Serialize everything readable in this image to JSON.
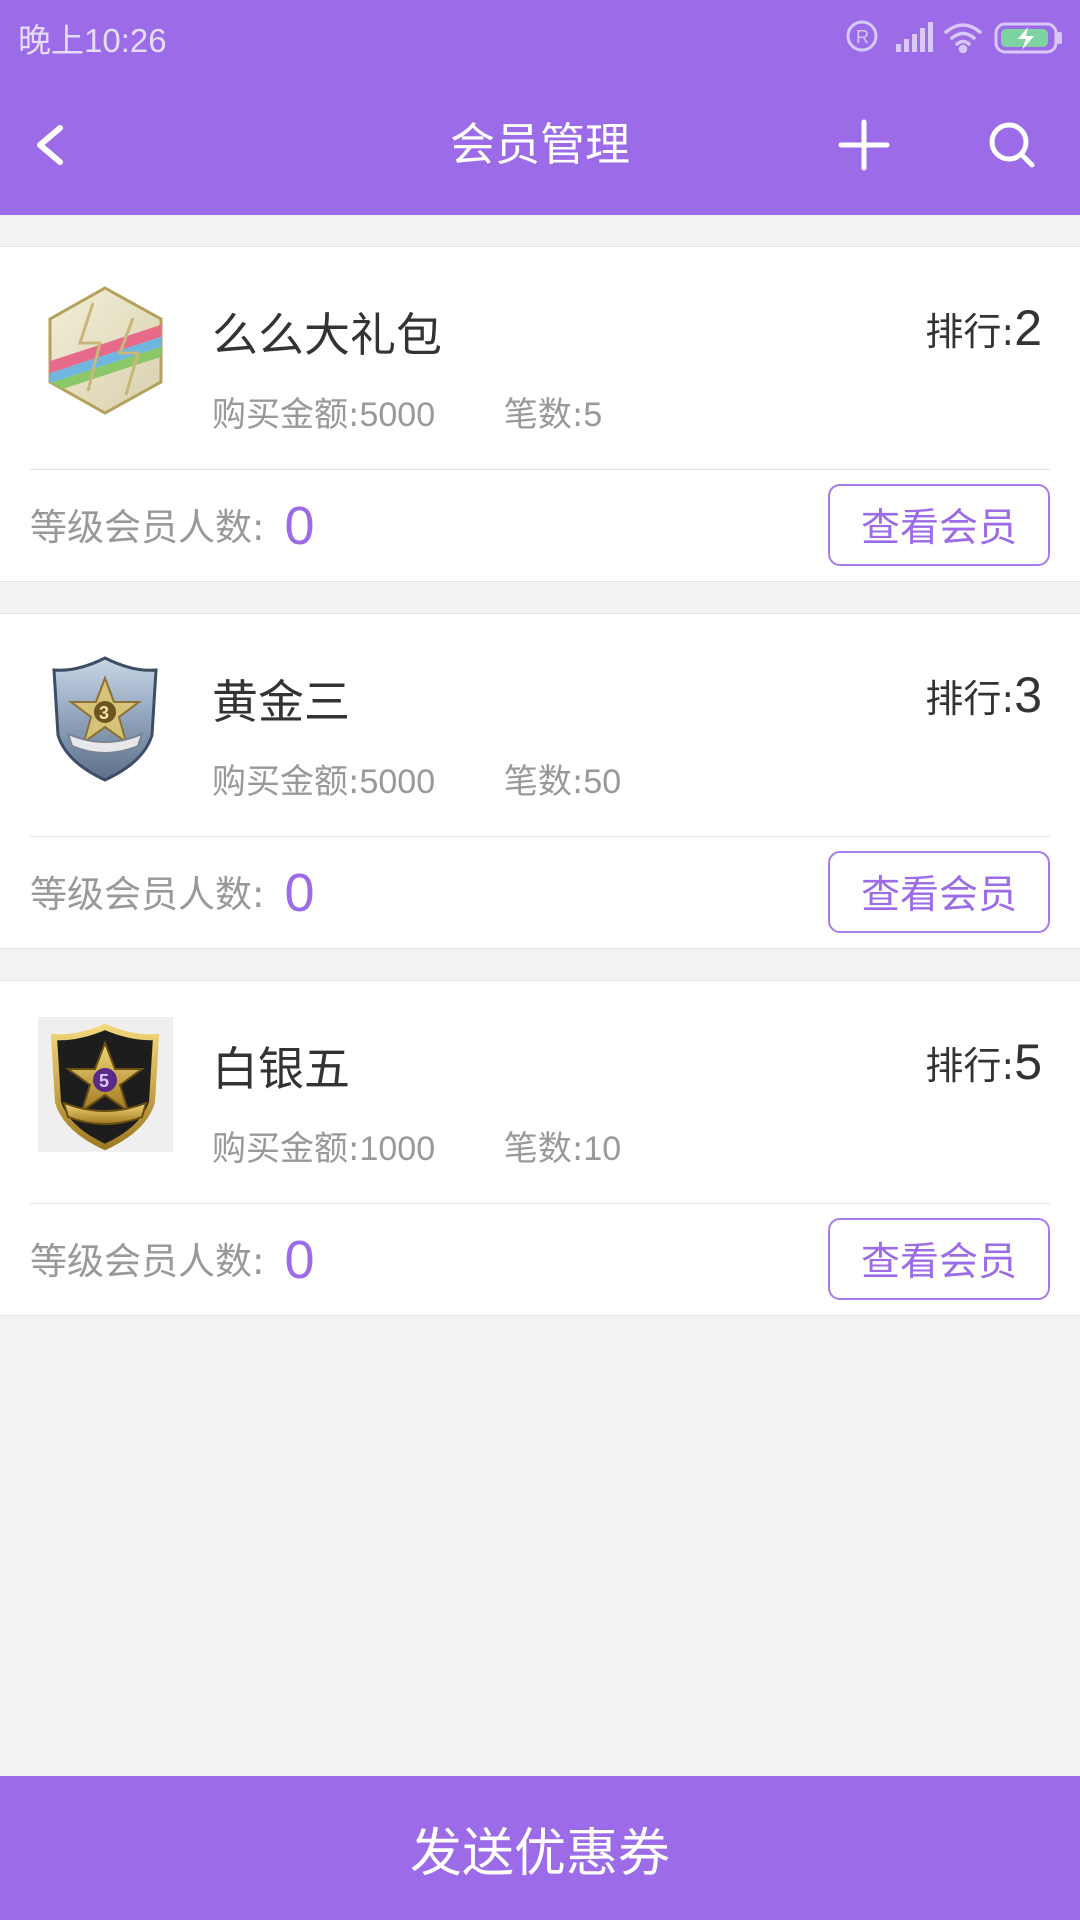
{
  "status_bar": {
    "time": "晚上10:26"
  },
  "header": {
    "title": "会员管理",
    "back_icon": "back-icon",
    "add_icon": "plus-icon",
    "search_icon": "search-icon"
  },
  "levels": [
    {
      "name": "么么大礼包",
      "rank_label": "排行:",
      "rank": "2",
      "amount_label": "购买金额:",
      "amount": "5000",
      "count_label": "笔数:",
      "count": "5",
      "members_label": "等级会员人数:",
      "members": "0",
      "button": "查看会员",
      "badge_icon": "hexagon-badge-icon"
    },
    {
      "name": "黄金三",
      "rank_label": "排行:",
      "rank": "3",
      "amount_label": "购买金额:",
      "amount": "5000",
      "count_label": "笔数:",
      "count": "50",
      "members_label": "等级会员人数:",
      "members": "0",
      "button": "查看会员",
      "badge_icon": "silver-shield-badge-icon"
    },
    {
      "name": "白银五",
      "rank_label": "排行:",
      "rank": "5",
      "amount_label": "购买金额:",
      "amount": "1000",
      "count_label": "笔数:",
      "count": "10",
      "members_label": "等级会员人数:",
      "members": "0",
      "button": "查看会员",
      "badge_icon": "black-shield-badge-icon"
    }
  ],
  "footer": {
    "button": "发送优惠券"
  },
  "colors": {
    "accent": "#9b6be8",
    "background": "#f3f3f3"
  }
}
